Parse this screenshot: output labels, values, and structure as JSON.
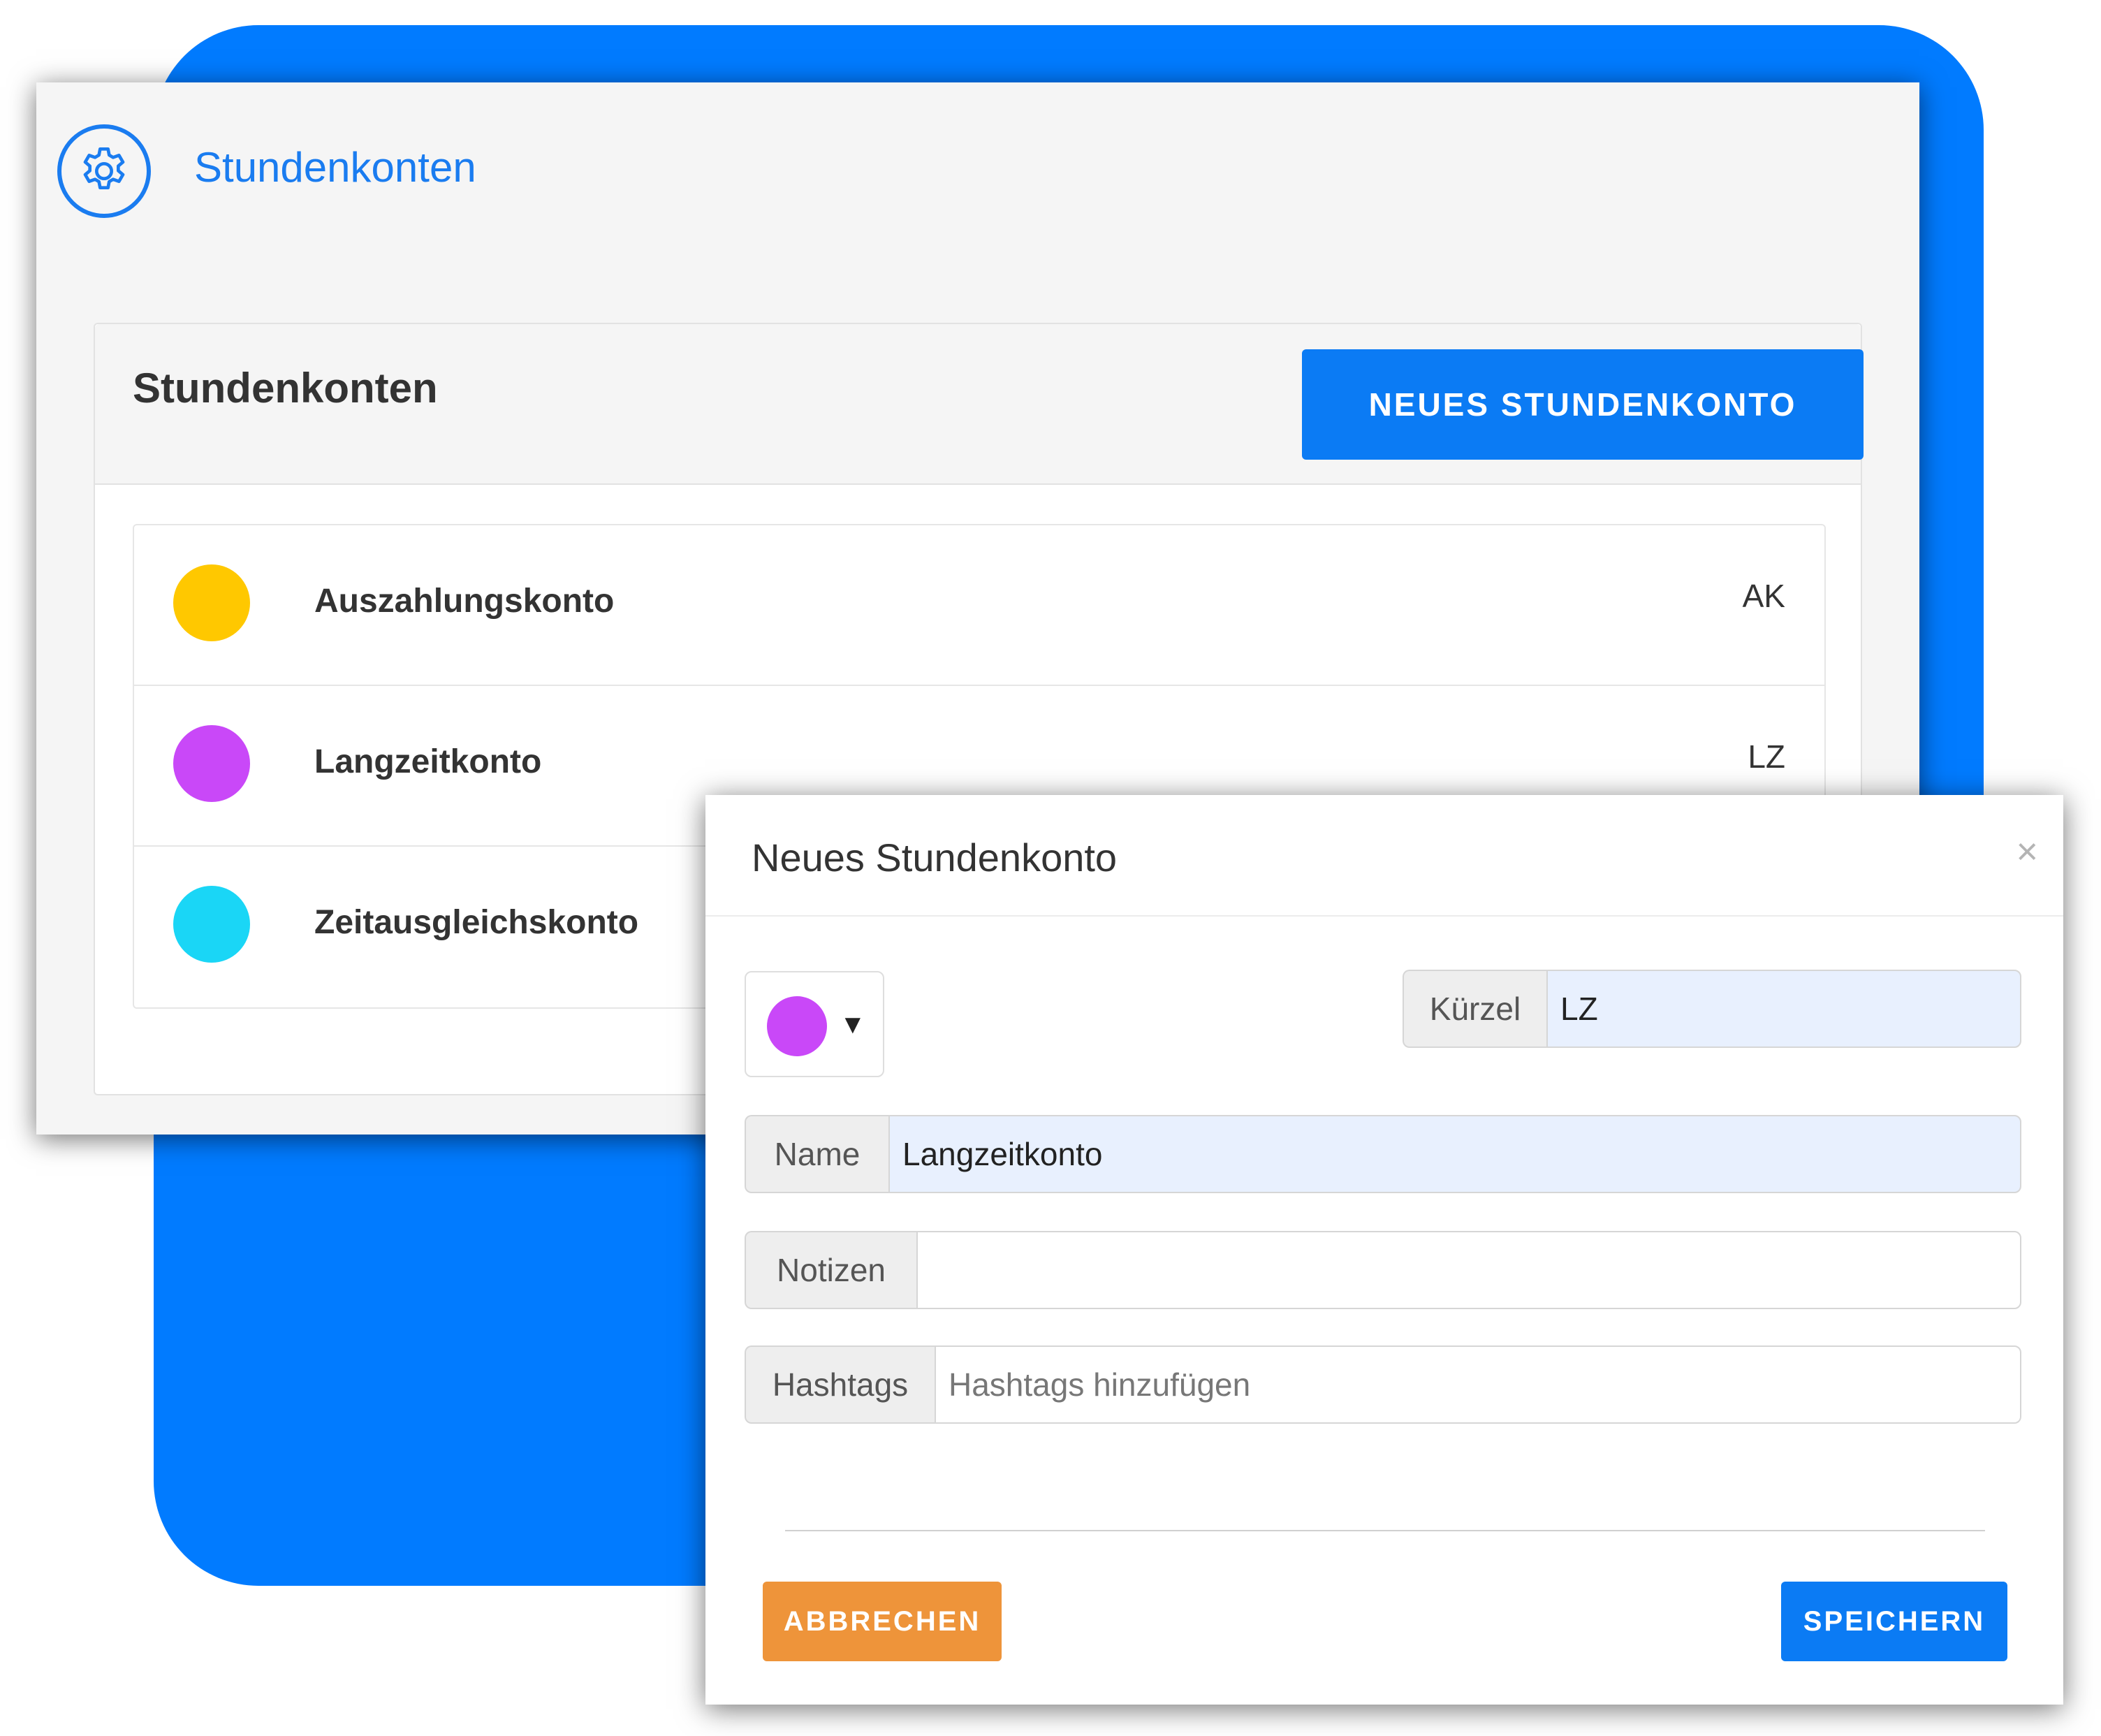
{
  "header": {
    "icon": "gear-icon",
    "title": "Stundenkonten"
  },
  "card": {
    "title": "Stundenkonten",
    "new_button_label": "NEUES STUNDENKONTO"
  },
  "accounts": [
    {
      "name": "Auszahlungskonto",
      "abbr": "AK",
      "color": "#ffc800"
    },
    {
      "name": "Langzeitkonto",
      "abbr": "LZ",
      "color": "#c948f8"
    },
    {
      "name": "Zeitausgleichskonto",
      "abbr": "",
      "color": "#1ad6f6"
    }
  ],
  "modal": {
    "title": "Neues Stundenkonto",
    "close_symbol": "×",
    "color_picker": {
      "selected_color": "#c948f8",
      "arrow": "▼"
    },
    "fields": {
      "kuerzel": {
        "label": "Kürzel",
        "value": "LZ"
      },
      "name": {
        "label": "Name",
        "value": "Langzeitkonto"
      },
      "notizen": {
        "label": "Notizen",
        "value": ""
      },
      "hashtags": {
        "label": "Hashtags",
        "value": "",
        "placeholder": "Hashtags hinzufügen"
      }
    },
    "cancel_label": "ABBRECHEN",
    "save_label": "SPEICHERN"
  },
  "colors": {
    "backdrop": "#017bff",
    "primary": "#0b7bf4",
    "cancel": "#ee943a"
  }
}
